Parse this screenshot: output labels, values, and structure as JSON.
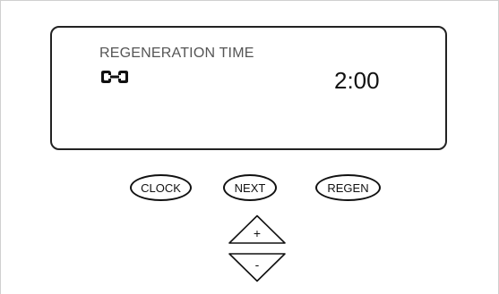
{
  "display": {
    "title": "REGENERATION TIME",
    "icon": "wrench-icon",
    "value": "2:00"
  },
  "buttons": {
    "clock": "CLOCK",
    "next": "NEXT",
    "regen": "REGEN"
  },
  "arrows": {
    "up": "+",
    "down": "-"
  }
}
